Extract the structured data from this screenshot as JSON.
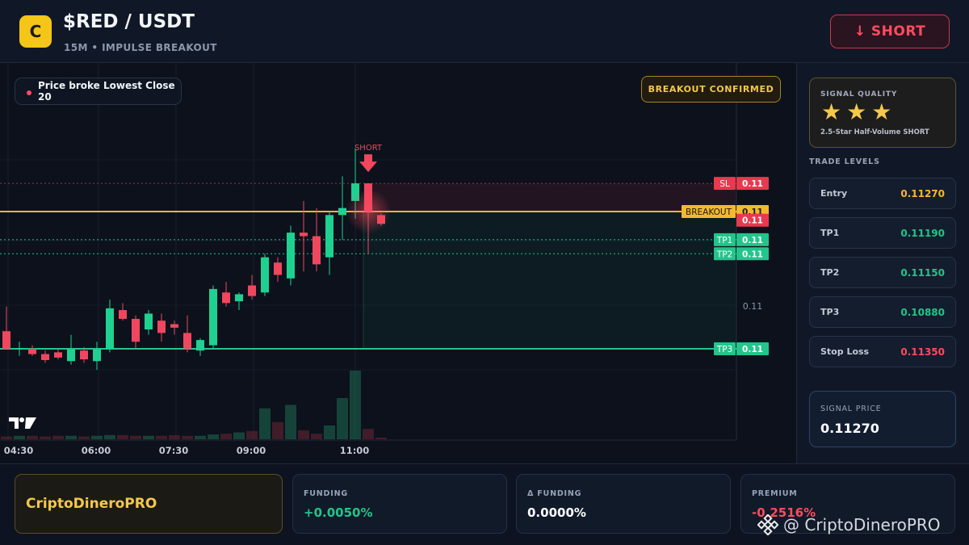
{
  "header": {
    "logo_letter": "C",
    "pair": "$RED / USDT",
    "subtitle": "15M • IMPULSE BREAKOUT",
    "action_label": "↓ SHORT"
  },
  "chart": {
    "event_label": "Price broke Lowest Close 20",
    "badge": "BREAKOUT CONFIRMED",
    "signal_marker": "SHORT",
    "x_ticks": [
      "04:30",
      "06:00",
      "07:30",
      "09:00",
      "11:00"
    ],
    "axis_label_mid": "0.11",
    "levels": [
      {
        "name": "SL",
        "value": "0.11",
        "price": 0.1135,
        "color": "#e8394f",
        "style": "dotted"
      },
      {
        "name": "BREAKOUT",
        "value": "0.11",
        "price": 0.1127,
        "color": "#f5b82e",
        "style": "solid"
      },
      {
        "name": "",
        "value": "0.11",
        "price": 0.1125,
        "color": "#e8394f",
        "style": "none"
      },
      {
        "name": "TP1",
        "value": "0.11",
        "price": 0.1119,
        "color": "#22c58a",
        "style": "dotted"
      },
      {
        "name": "TP2",
        "value": "0.11",
        "price": 0.1115,
        "color": "#22c58a",
        "style": "dotted"
      },
      {
        "name": "TP3",
        "value": "0.11",
        "price": 0.1088,
        "color": "#22c58a",
        "style": "solid"
      }
    ]
  },
  "chart_data": {
    "type": "candlestick",
    "title": "$RED / USDT",
    "x": [
      "04:30",
      "06:00",
      "07:30",
      "09:00",
      "11:00"
    ],
    "ylim": [
      0.107,
      0.116
    ],
    "candles": [
      {
        "o": 0.1093,
        "h": 0.11,
        "l": 0.1088,
        "c": 0.1088
      },
      {
        "o": 0.1088,
        "h": 0.109,
        "l": 0.1086,
        "c": 0.10882
      },
      {
        "o": 0.1088,
        "h": 0.1089,
        "l": 0.1086,
        "c": 0.10865
      },
      {
        "o": 0.10865,
        "h": 0.10875,
        "l": 0.1084,
        "c": 0.10848
      },
      {
        "o": 0.1087,
        "h": 0.1088,
        "l": 0.1085,
        "c": 0.10855
      },
      {
        "o": 0.10845,
        "h": 0.1092,
        "l": 0.10835,
        "c": 0.1088
      },
      {
        "o": 0.10875,
        "h": 0.10885,
        "l": 0.1084,
        "c": 0.1085
      },
      {
        "o": 0.10845,
        "h": 0.109,
        "l": 0.1082,
        "c": 0.1088
      },
      {
        "o": 0.1088,
        "h": 0.1102,
        "l": 0.1087,
        "c": 0.10995
      },
      {
        "o": 0.1099,
        "h": 0.1101,
        "l": 0.1096,
        "c": 0.10965
      },
      {
        "o": 0.10965,
        "h": 0.10975,
        "l": 0.1088,
        "c": 0.109
      },
      {
        "o": 0.10935,
        "h": 0.1099,
        "l": 0.1092,
        "c": 0.1098
      },
      {
        "o": 0.1096,
        "h": 0.1098,
        "l": 0.109,
        "c": 0.10925
      },
      {
        "o": 0.1095,
        "h": 0.1096,
        "l": 0.1092,
        "c": 0.1094
      },
      {
        "o": 0.10925,
        "h": 0.10975,
        "l": 0.1087,
        "c": 0.1088
      },
      {
        "o": 0.10875,
        "h": 0.1091,
        "l": 0.1086,
        "c": 0.10905
      },
      {
        "o": 0.1089,
        "h": 0.1106,
        "l": 0.1088,
        "c": 0.1105
      },
      {
        "o": 0.1104,
        "h": 0.1107,
        "l": 0.11,
        "c": 0.1101
      },
      {
        "o": 0.11015,
        "h": 0.1104,
        "l": 0.1099,
        "c": 0.11035
      },
      {
        "o": 0.1106,
        "h": 0.1109,
        "l": 0.1102,
        "c": 0.1103
      },
      {
        "o": 0.1104,
        "h": 0.1115,
        "l": 0.1103,
        "c": 0.1114
      },
      {
        "o": 0.11125,
        "h": 0.1114,
        "l": 0.1107,
        "c": 0.1109
      },
      {
        "o": 0.1108,
        "h": 0.1123,
        "l": 0.1106,
        "c": 0.1121
      },
      {
        "o": 0.1121,
        "h": 0.113,
        "l": 0.111,
        "c": 0.112
      },
      {
        "o": 0.112,
        "h": 0.1128,
        "l": 0.111,
        "c": 0.1112
      },
      {
        "o": 0.1114,
        "h": 0.1127,
        "l": 0.1109,
        "c": 0.1126
      },
      {
        "o": 0.1126,
        "h": 0.1137,
        "l": 0.1119,
        "c": 0.1128
      },
      {
        "o": 0.113,
        "h": 0.1145,
        "l": 0.1125,
        "c": 0.1135
      },
      {
        "o": 0.1135,
        "h": 0.1135,
        "l": 0.1115,
        "c": 0.1127
      },
      {
        "o": 0.1126,
        "h": 0.11265,
        "l": 0.1123,
        "c": 0.11235
      }
    ],
    "volume": [
      0.04,
      0.05,
      0.05,
      0.04,
      0.05,
      0.05,
      0.04,
      0.05,
      0.06,
      0.06,
      0.05,
      0.05,
      0.05,
      0.06,
      0.05,
      0.05,
      0.07,
      0.08,
      0.1,
      0.12,
      0.45,
      0.25,
      0.5,
      0.13,
      0.08,
      0.2,
      0.6,
      1.0,
      0.15,
      0.02
    ],
    "annotations": [
      {
        "label": "SHORT",
        "candle": 28
      }
    ]
  },
  "right_panel": {
    "quality_title": "SIGNAL QUALITY",
    "stars": 3,
    "quality_desc": "2.5-Star Half-Volume SHORT",
    "levels_title": "TRADE LEVELS",
    "levels": [
      {
        "label": "Entry",
        "value": "0.11270",
        "color": "#f5b82e"
      },
      {
        "label": "TP1",
        "value": "0.11190",
        "color": "#22c58a"
      },
      {
        "label": "TP2",
        "value": "0.11150",
        "color": "#22c58a"
      },
      {
        "label": "TP3",
        "value": "0.10880",
        "color": "#22c58a"
      },
      {
        "label": "Stop Loss",
        "value": "0.11350",
        "color": "#ff4b5f"
      }
    ],
    "signal_label": "SIGNAL PRICE",
    "signal_value": "0.11270"
  },
  "footer": {
    "brand": "CriptoDineroPRO",
    "stats": [
      {
        "label": "FUNDING",
        "value": "+0.0050%",
        "color": "#22c58a"
      },
      {
        "label": "Δ FUNDING",
        "value": "0.0000%",
        "color": "#ffffff"
      },
      {
        "label": "PREMIUM",
        "value": "-0.2516%",
        "color": "#ff4b5f"
      }
    ],
    "watermark": "@ CriptoDineroPRO"
  }
}
